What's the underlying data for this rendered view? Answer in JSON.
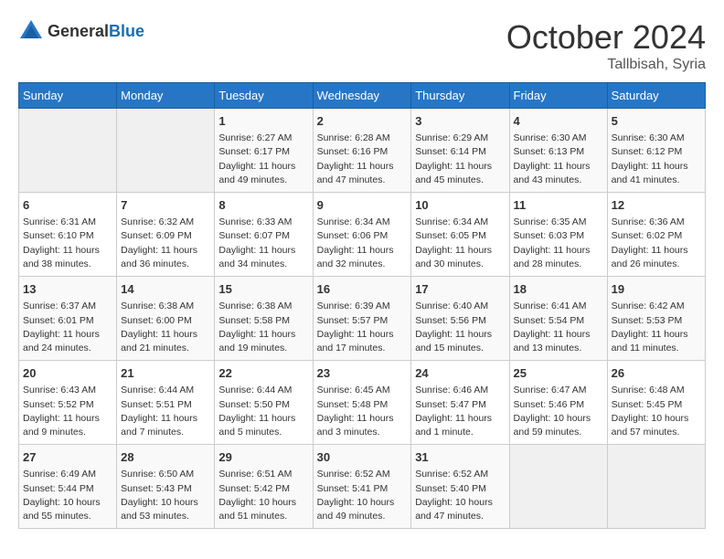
{
  "logo": {
    "general": "General",
    "blue": "Blue"
  },
  "header": {
    "month": "October 2024",
    "location": "Tallbisah, Syria"
  },
  "weekdays": [
    "Sunday",
    "Monday",
    "Tuesday",
    "Wednesday",
    "Thursday",
    "Friday",
    "Saturday"
  ],
  "weeks": [
    [
      {
        "day": "",
        "sunrise": "",
        "sunset": "",
        "daylight": ""
      },
      {
        "day": "",
        "sunrise": "",
        "sunset": "",
        "daylight": ""
      },
      {
        "day": "1",
        "sunrise": "Sunrise: 6:27 AM",
        "sunset": "Sunset: 6:17 PM",
        "daylight": "Daylight: 11 hours and 49 minutes."
      },
      {
        "day": "2",
        "sunrise": "Sunrise: 6:28 AM",
        "sunset": "Sunset: 6:16 PM",
        "daylight": "Daylight: 11 hours and 47 minutes."
      },
      {
        "day": "3",
        "sunrise": "Sunrise: 6:29 AM",
        "sunset": "Sunset: 6:14 PM",
        "daylight": "Daylight: 11 hours and 45 minutes."
      },
      {
        "day": "4",
        "sunrise": "Sunrise: 6:30 AM",
        "sunset": "Sunset: 6:13 PM",
        "daylight": "Daylight: 11 hours and 43 minutes."
      },
      {
        "day": "5",
        "sunrise": "Sunrise: 6:30 AM",
        "sunset": "Sunset: 6:12 PM",
        "daylight": "Daylight: 11 hours and 41 minutes."
      }
    ],
    [
      {
        "day": "6",
        "sunrise": "Sunrise: 6:31 AM",
        "sunset": "Sunset: 6:10 PM",
        "daylight": "Daylight: 11 hours and 38 minutes."
      },
      {
        "day": "7",
        "sunrise": "Sunrise: 6:32 AM",
        "sunset": "Sunset: 6:09 PM",
        "daylight": "Daylight: 11 hours and 36 minutes."
      },
      {
        "day": "8",
        "sunrise": "Sunrise: 6:33 AM",
        "sunset": "Sunset: 6:07 PM",
        "daylight": "Daylight: 11 hours and 34 minutes."
      },
      {
        "day": "9",
        "sunrise": "Sunrise: 6:34 AM",
        "sunset": "Sunset: 6:06 PM",
        "daylight": "Daylight: 11 hours and 32 minutes."
      },
      {
        "day": "10",
        "sunrise": "Sunrise: 6:34 AM",
        "sunset": "Sunset: 6:05 PM",
        "daylight": "Daylight: 11 hours and 30 minutes."
      },
      {
        "day": "11",
        "sunrise": "Sunrise: 6:35 AM",
        "sunset": "Sunset: 6:03 PM",
        "daylight": "Daylight: 11 hours and 28 minutes."
      },
      {
        "day": "12",
        "sunrise": "Sunrise: 6:36 AM",
        "sunset": "Sunset: 6:02 PM",
        "daylight": "Daylight: 11 hours and 26 minutes."
      }
    ],
    [
      {
        "day": "13",
        "sunrise": "Sunrise: 6:37 AM",
        "sunset": "Sunset: 6:01 PM",
        "daylight": "Daylight: 11 hours and 24 minutes."
      },
      {
        "day": "14",
        "sunrise": "Sunrise: 6:38 AM",
        "sunset": "Sunset: 6:00 PM",
        "daylight": "Daylight: 11 hours and 21 minutes."
      },
      {
        "day": "15",
        "sunrise": "Sunrise: 6:38 AM",
        "sunset": "Sunset: 5:58 PM",
        "daylight": "Daylight: 11 hours and 19 minutes."
      },
      {
        "day": "16",
        "sunrise": "Sunrise: 6:39 AM",
        "sunset": "Sunset: 5:57 PM",
        "daylight": "Daylight: 11 hours and 17 minutes."
      },
      {
        "day": "17",
        "sunrise": "Sunrise: 6:40 AM",
        "sunset": "Sunset: 5:56 PM",
        "daylight": "Daylight: 11 hours and 15 minutes."
      },
      {
        "day": "18",
        "sunrise": "Sunrise: 6:41 AM",
        "sunset": "Sunset: 5:54 PM",
        "daylight": "Daylight: 11 hours and 13 minutes."
      },
      {
        "day": "19",
        "sunrise": "Sunrise: 6:42 AM",
        "sunset": "Sunset: 5:53 PM",
        "daylight": "Daylight: 11 hours and 11 minutes."
      }
    ],
    [
      {
        "day": "20",
        "sunrise": "Sunrise: 6:43 AM",
        "sunset": "Sunset: 5:52 PM",
        "daylight": "Daylight: 11 hours and 9 minutes."
      },
      {
        "day": "21",
        "sunrise": "Sunrise: 6:44 AM",
        "sunset": "Sunset: 5:51 PM",
        "daylight": "Daylight: 11 hours and 7 minutes."
      },
      {
        "day": "22",
        "sunrise": "Sunrise: 6:44 AM",
        "sunset": "Sunset: 5:50 PM",
        "daylight": "Daylight: 11 hours and 5 minutes."
      },
      {
        "day": "23",
        "sunrise": "Sunrise: 6:45 AM",
        "sunset": "Sunset: 5:48 PM",
        "daylight": "Daylight: 11 hours and 3 minutes."
      },
      {
        "day": "24",
        "sunrise": "Sunrise: 6:46 AM",
        "sunset": "Sunset: 5:47 PM",
        "daylight": "Daylight: 11 hours and 1 minute."
      },
      {
        "day": "25",
        "sunrise": "Sunrise: 6:47 AM",
        "sunset": "Sunset: 5:46 PM",
        "daylight": "Daylight: 10 hours and 59 minutes."
      },
      {
        "day": "26",
        "sunrise": "Sunrise: 6:48 AM",
        "sunset": "Sunset: 5:45 PM",
        "daylight": "Daylight: 10 hours and 57 minutes."
      }
    ],
    [
      {
        "day": "27",
        "sunrise": "Sunrise: 6:49 AM",
        "sunset": "Sunset: 5:44 PM",
        "daylight": "Daylight: 10 hours and 55 minutes."
      },
      {
        "day": "28",
        "sunrise": "Sunrise: 6:50 AM",
        "sunset": "Sunset: 5:43 PM",
        "daylight": "Daylight: 10 hours and 53 minutes."
      },
      {
        "day": "29",
        "sunrise": "Sunrise: 6:51 AM",
        "sunset": "Sunset: 5:42 PM",
        "daylight": "Daylight: 10 hours and 51 minutes."
      },
      {
        "day": "30",
        "sunrise": "Sunrise: 6:52 AM",
        "sunset": "Sunset: 5:41 PM",
        "daylight": "Daylight: 10 hours and 49 minutes."
      },
      {
        "day": "31",
        "sunrise": "Sunrise: 6:52 AM",
        "sunset": "Sunset: 5:40 PM",
        "daylight": "Daylight: 10 hours and 47 minutes."
      },
      {
        "day": "",
        "sunrise": "",
        "sunset": "",
        "daylight": ""
      },
      {
        "day": "",
        "sunrise": "",
        "sunset": "",
        "daylight": ""
      }
    ]
  ]
}
